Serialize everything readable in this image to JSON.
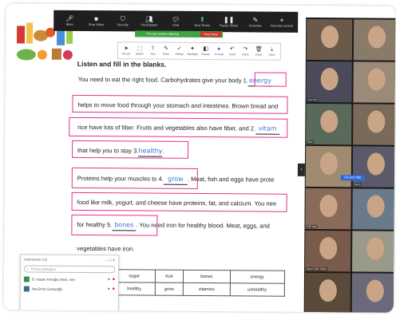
{
  "zoom_toolbar": {
    "items": [
      {
        "label": "Mute",
        "icon": "mic-icon"
      },
      {
        "label": "Stop Video",
        "icon": "video-icon"
      },
      {
        "label": "Security",
        "icon": "shield-icon"
      },
      {
        "label": "Participants",
        "icon": "participants-icon"
      },
      {
        "label": "Chat",
        "icon": "chat-icon"
      },
      {
        "label": "New Share",
        "icon": "share-icon"
      },
      {
        "label": "Pause Share",
        "icon": "pause-icon"
      },
      {
        "label": "Annotate",
        "icon": "pencil-icon"
      },
      {
        "label": "Remote Control",
        "icon": "remote-icon"
      }
    ],
    "share_banner": "You are screen sharing",
    "stop_share": "Stop Share"
  },
  "annotation_toolbar": {
    "items": [
      {
        "label": "Mouse",
        "icon": "cursor-icon"
      },
      {
        "label": "Select",
        "icon": "select-icon"
      },
      {
        "label": "Text",
        "icon": "text-icon"
      },
      {
        "label": "Draw",
        "icon": "pen-icon"
      },
      {
        "label": "Stamp",
        "icon": "stamp-icon"
      },
      {
        "label": "Spotlight",
        "icon": "spotlight-icon"
      },
      {
        "label": "Eraser",
        "icon": "eraser-icon"
      },
      {
        "label": "Format",
        "icon": "format-icon"
      },
      {
        "label": "Undo",
        "icon": "undo-icon"
      },
      {
        "label": "Redo",
        "icon": "redo-icon"
      },
      {
        "label": "Clear",
        "icon": "trash-icon"
      },
      {
        "label": "Save",
        "icon": "save-icon"
      }
    ]
  },
  "worksheet": {
    "instruction": "Listen and fill in the blanks.",
    "lines": [
      {
        "pre": "You need to eat the right food. Carbohydrates give your body 1.",
        "blank": "energy",
        "post": ""
      },
      {
        "pre": "helps to move food through your stomach and intestines. Brown bread and",
        "blank": "",
        "post": ""
      },
      {
        "pre": "rice have lots of fiber. Fruits and vegetables also have fiber, and 2.",
        "blank": "vitam",
        "post": ""
      },
      {
        "pre": "that help you to stay 3.",
        "blank": "healthy",
        "post": "."
      },
      {
        "pre": "Proteins help your muscles to 4.",
        "blank": "grow",
        "post": ". Meat, fish and eggs have prote"
      },
      {
        "pre": "food like milk, yogurt, and cheese have proteins, fat, and calcium. You nee",
        "blank": "",
        "post": ""
      },
      {
        "pre": "for healthy 5.",
        "blank": "bones",
        "post": ". You need iron for healthy blood. Meat, eggs, and"
      },
      {
        "pre": "vegetables have iron.",
        "blank": "",
        "post": ""
      }
    ],
    "word_bank": [
      [
        "sugar",
        "fruit",
        "bones",
        "energy"
      ],
      [
        "healthy",
        "grow",
        "vitamins",
        "unhealthy"
      ]
    ]
  },
  "participants_panel": {
    "title": "Participants (15)",
    "search_placeholder": "Find a participant",
    "rows": [
      {
        "name": "Ö. Hasan Keroğlu (Host, me)"
      },
      {
        "name": "Ata Emre Çevayoğlu"
      }
    ]
  },
  "gallery": {
    "tiles": [
      {
        "name": ""
      },
      {
        "name": ""
      },
      {
        "name": "Ela Gül"
      },
      {
        "name": ""
      },
      {
        "name": "Ekin"
      },
      {
        "name": ""
      },
      {
        "name": ""
      },
      {
        "name": "Derin"
      },
      {
        "name": "Elif Naz"
      },
      {
        "name": ""
      },
      {
        "name": "Mavi Eylül Dilek"
      },
      {
        "name": ""
      },
      {
        "name": ""
      },
      {
        "name": ""
      }
    ],
    "highlight_button": "Ela Gül Tülkü"
  },
  "colors": {
    "annotation_box": "#e0338d",
    "typed_text": "#3d73d8",
    "share_green": "#3fa33f",
    "stop_red": "#d62f2f"
  }
}
